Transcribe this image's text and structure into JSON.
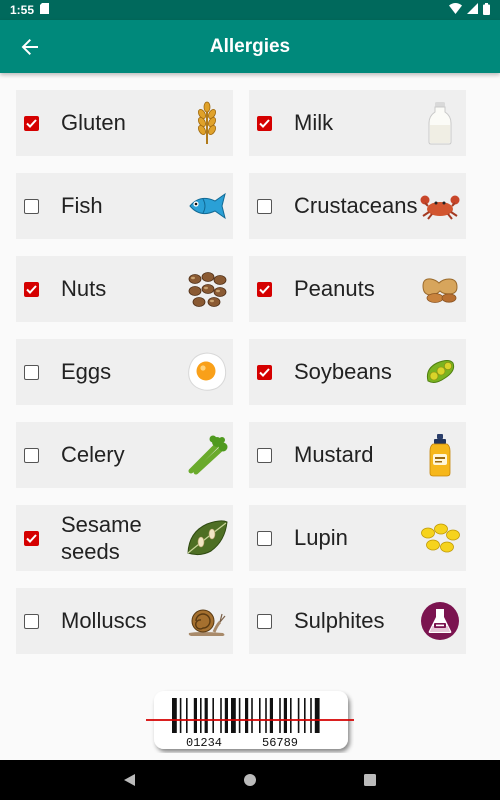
{
  "status_bar": {
    "time": "1:55"
  },
  "app_bar": {
    "title": "Allergies"
  },
  "allergens": [
    {
      "label": "Gluten",
      "checked": true,
      "icon": "wheat-icon"
    },
    {
      "label": "Milk",
      "checked": true,
      "icon": "milk-bottle-icon"
    },
    {
      "label": "Fish",
      "checked": false,
      "icon": "fish-icon"
    },
    {
      "label": "Crustaceans",
      "checked": false,
      "icon": "crab-icon"
    },
    {
      "label": "Nuts",
      "checked": true,
      "icon": "nuts-icon"
    },
    {
      "label": "Peanuts",
      "checked": true,
      "icon": "peanut-icon"
    },
    {
      "label": "Eggs",
      "checked": false,
      "icon": "fried-egg-icon"
    },
    {
      "label": "Soybeans",
      "checked": true,
      "icon": "soybean-icon"
    },
    {
      "label": "Celery",
      "checked": false,
      "icon": "celery-icon"
    },
    {
      "label": "Mustard",
      "checked": false,
      "icon": "mustard-bottle-icon"
    },
    {
      "label": "Sesame seeds",
      "checked": true,
      "icon": "sesame-leaf-icon"
    },
    {
      "label": "Lupin",
      "checked": false,
      "icon": "lupin-beans-icon"
    },
    {
      "label": "Molluscs",
      "checked": false,
      "icon": "snail-icon"
    },
    {
      "label": "Sulphites",
      "checked": false,
      "icon": "sulphites-flask-icon"
    }
  ],
  "barcode": {
    "left_digits": "01234",
    "right_digits": "56789"
  },
  "colors": {
    "primary": "#00897b",
    "primary_dark": "#00695c",
    "checkbox_checked": "#d50000",
    "cell_background": "#efefef"
  }
}
